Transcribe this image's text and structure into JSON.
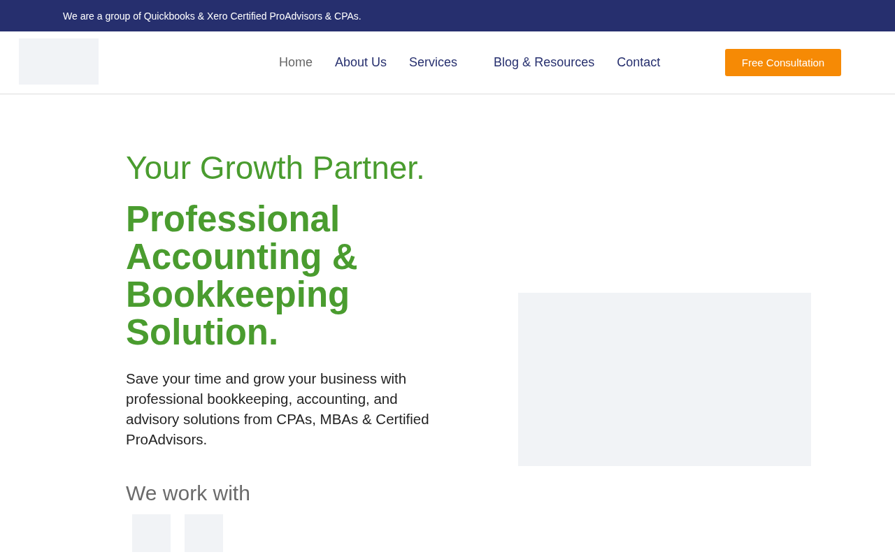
{
  "top_bar": {
    "text": "We are a group of Quickbooks & Xero Certified ProAdvisors & CPAs."
  },
  "header": {
    "logo": {
      "kind": "placeholder"
    },
    "nav": [
      {
        "label": "Home",
        "selected": true
      },
      {
        "label": "About Us",
        "selected": false
      },
      {
        "label": "Services",
        "selected": false
      },
      {
        "label": "Blog & Resources",
        "selected": false
      },
      {
        "label": "Contact",
        "selected": false
      }
    ],
    "cta": "Free Consultation"
  },
  "hero": {
    "tagline": "Your Growth Partner.",
    "heading": "Professional Accounting & Bookkeeping Solution.",
    "description": "Save your time and grow your business with professional bookkeeping, accounting, and advisory solutions from CPAs, MBAs & Certified ProAdvisors.",
    "partners_title": "We work with",
    "partners": [
      {
        "kind": "placeholder"
      },
      {
        "kind": "placeholder"
      }
    ],
    "image": {
      "kind": "placeholder"
    }
  }
}
